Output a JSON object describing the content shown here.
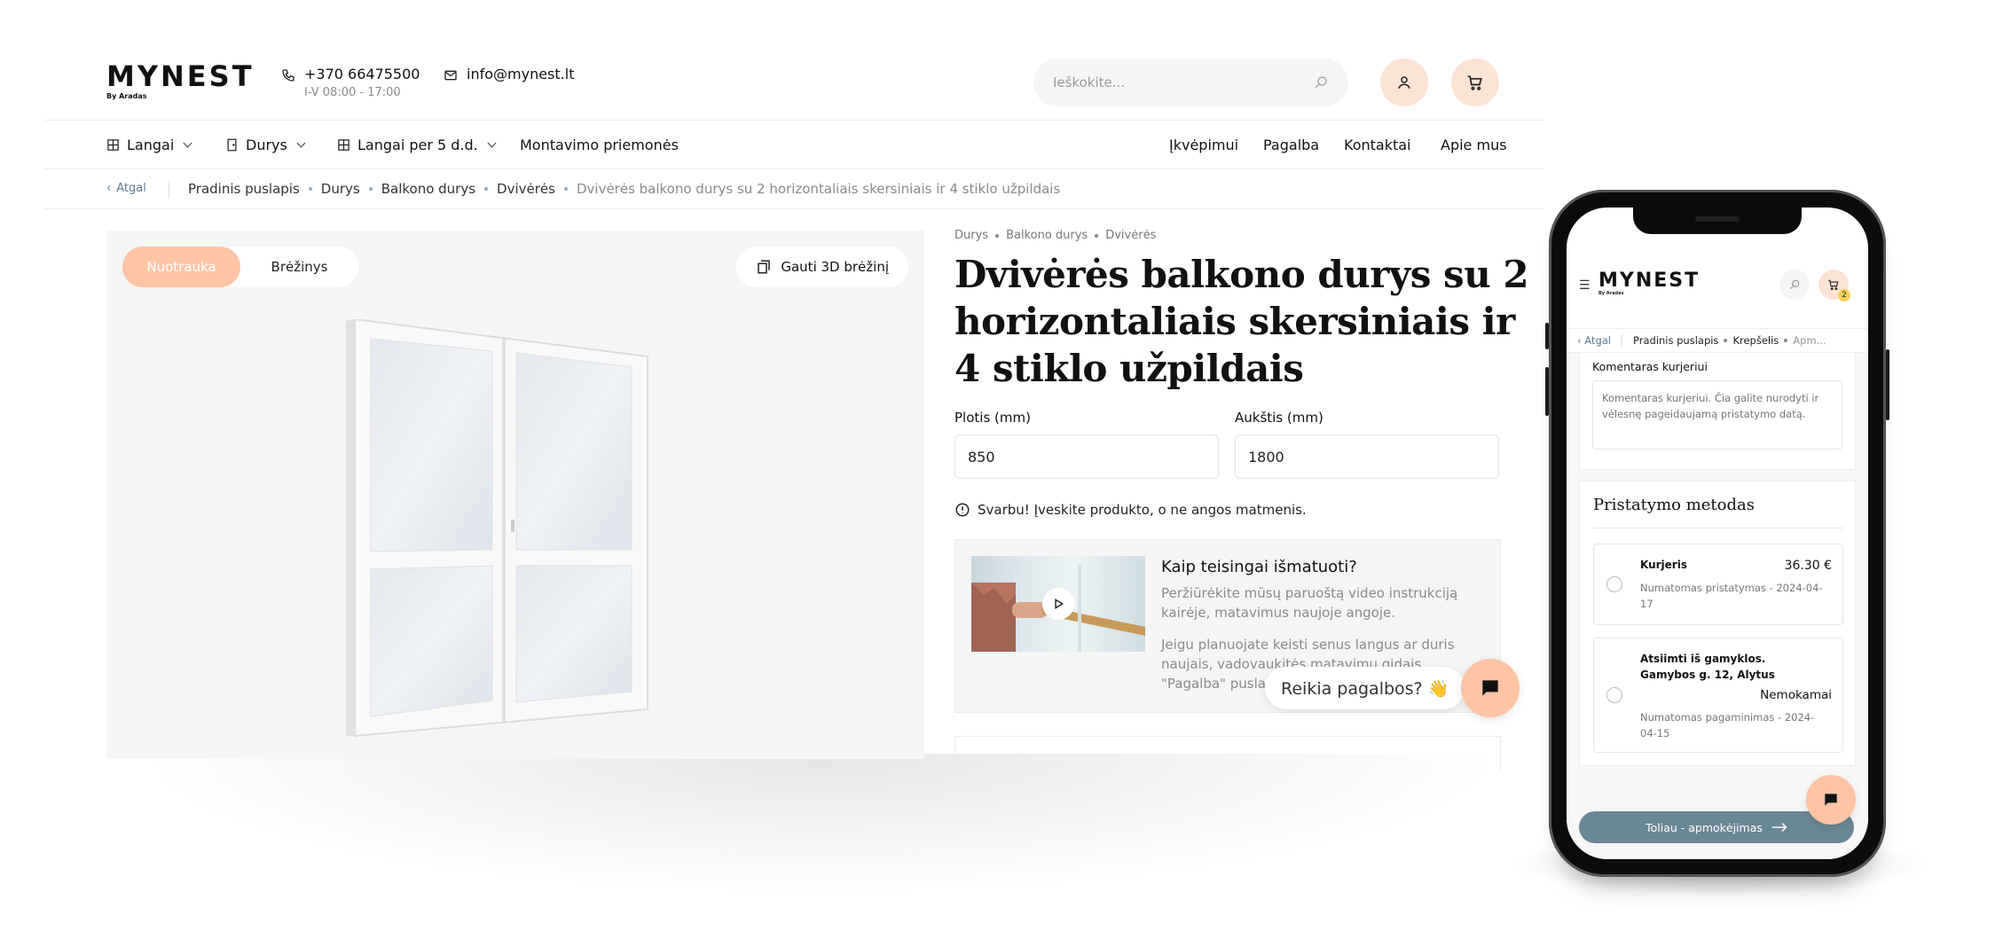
{
  "header": {
    "logo": "MYNEST",
    "logo_sub": "By Aradas",
    "phone": "+370 66475500",
    "hours": "I-V 08:00 - 17:00",
    "email": "info@mynest.lt",
    "search_placeholder": "Ieškokite..."
  },
  "nav": {
    "left": [
      "Langai",
      "Durys",
      "Langai per 5 d.d.",
      "Montavimo priemonės"
    ],
    "right": [
      "Įkvėpimui",
      "Pagalba",
      "Kontaktai",
      "Apie mus"
    ]
  },
  "breadcrumb": {
    "back": "Atgal",
    "items": [
      "Pradinis puslapis",
      "Durys",
      "Balkono durys",
      "Dvivėrės"
    ],
    "current": "Dvivėrės balkono durys su 2 horizontaliais skersiniais ir 4 stiklo užpildais"
  },
  "gallery": {
    "tab_photo": "Nuotrauka",
    "tab_drawing": "Brėžinys",
    "btn_3d": "Gauti 3D brėžinį"
  },
  "product": {
    "crumbs": [
      "Durys",
      "Balkono durys",
      "Dvivėrės"
    ],
    "title": "Dvivėrės balkono durys su 2 horizontaliais skersiniais ir 4 stiklo užpildais",
    "width_label": "Plotis (mm)",
    "width_value": "850",
    "height_label": "Aukštis (mm)",
    "height_value": "1800",
    "warning": "Svarbu! Įveskite produkto, o ne angos matmenis.",
    "video_title": "Kaip teisingai išmatuoti?",
    "video_text1": "Peržiūrėkite mūsų paruoštą video instrukciją kairėje, matavimus naujoje angoje.",
    "video_text2": "Jeigu planuojate keisti senus langus ar duris naujais, vadovaukitės matavimų gidais \"Pagalba\" puslapyje."
  },
  "help": {
    "bubble": "Reikia pagalbos? 👋"
  },
  "phone": {
    "logo": "MYNEST",
    "logo_sub": "By Aradas",
    "cart_count": "2",
    "crumbs_back": "Atgal",
    "crumbs": [
      "Pradinis puslapis",
      "Krepšelis",
      "Apm..."
    ],
    "comment_label": "Komentaras kurjeriui",
    "comment_placeholder": "Komentaras kurjeriui. Čia galite nurodyti ir vėlesnę pageidaujamą pristatymo datą.",
    "delivery_title": "Pristatymo metodas",
    "option1_name": "Kurjeris",
    "option1_price": "36.30 €",
    "option1_note": "Numatomas pristatymas - 2024-04-17",
    "option2_name": "Atsiimti iš gamyklos. Gamybos g. 12, Alytus",
    "option2_price": "Nemokamai",
    "option2_note": "Numatomas pagaminimas - 2024-04-15",
    "cta": "Toliau - apmokėjimas"
  },
  "colors": {
    "accent": "#fdc4a5",
    "accent_light": "#fde3d3",
    "cta": "#6a8796",
    "link": "#5a7a8f"
  }
}
